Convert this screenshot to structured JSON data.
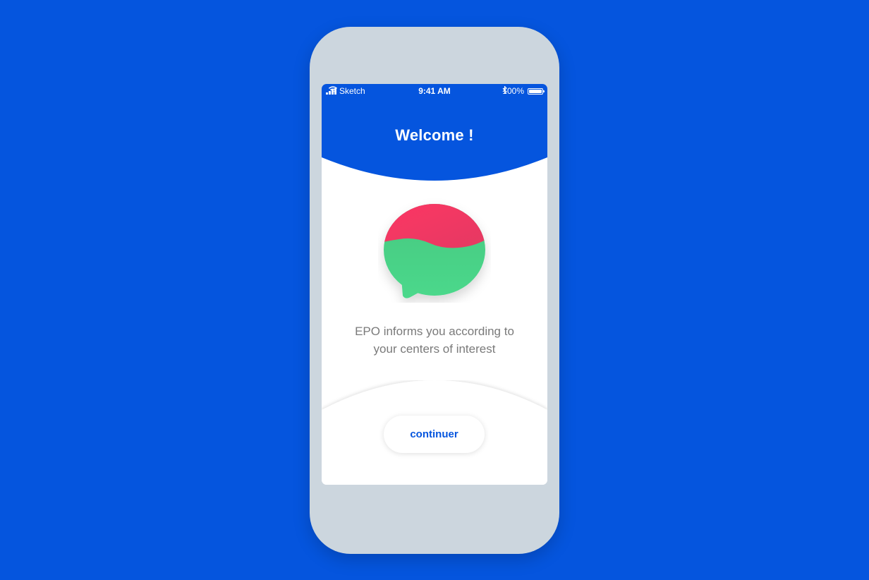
{
  "status_bar": {
    "carrier": "Sketch",
    "time": "9:41 AM",
    "battery": "100%"
  },
  "header": {
    "title": "Welcome !"
  },
  "logo": {
    "icon": "chat-bubble-logo-icon",
    "top_color": "#FF3565",
    "bottom_color": "#49D589"
  },
  "main": {
    "description_line1": "EPO informs you according to",
    "description_line2": "your centers of interest"
  },
  "footer": {
    "continue_label": "continuer"
  },
  "colors": {
    "background": "#0555DE",
    "accent": "#0555DE",
    "phone_frame": "#CCD6DE",
    "text_muted": "#7A7A7A"
  }
}
